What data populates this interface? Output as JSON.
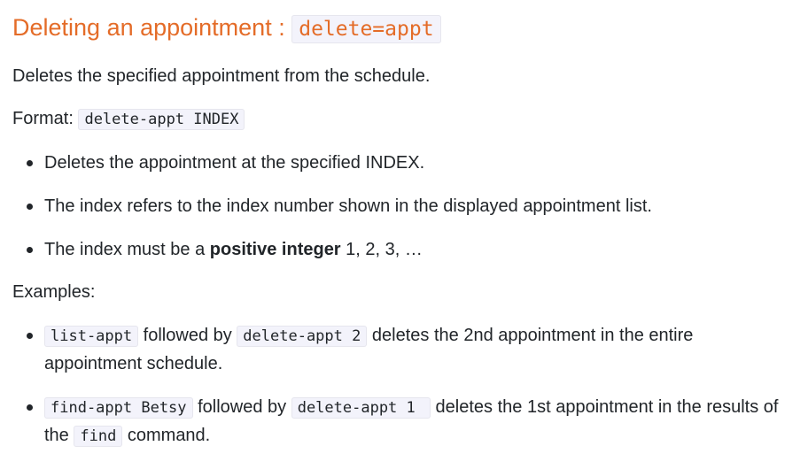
{
  "heading": {
    "text": "Deleting an appointment : ",
    "code": "delete=appt"
  },
  "description": "Deletes the specified appointment from the schedule.",
  "format": {
    "label": "Format: ",
    "code": "delete-appt INDEX"
  },
  "rules": [
    {
      "text": "Deletes the appointment at the specified INDEX."
    },
    {
      "text": "The index refers to the index number shown in the displayed appointment list."
    },
    {
      "before": "The index must be a ",
      "bold": "positive integer",
      "after": " 1, 2, 3, …"
    }
  ],
  "examples_label": "Examples:",
  "examples": [
    {
      "code1": "list-appt",
      "mid": " followed by ",
      "code2": "delete-appt 2",
      "after": " deletes the 2nd appointment in the entire appointment schedule."
    },
    {
      "code1": "find-appt Betsy",
      "mid": " followed by ",
      "code2": "delete-appt 1 ",
      "after": " deletes the 1st appointment in the results of the ",
      "code3": "find",
      "end": " command."
    }
  ]
}
